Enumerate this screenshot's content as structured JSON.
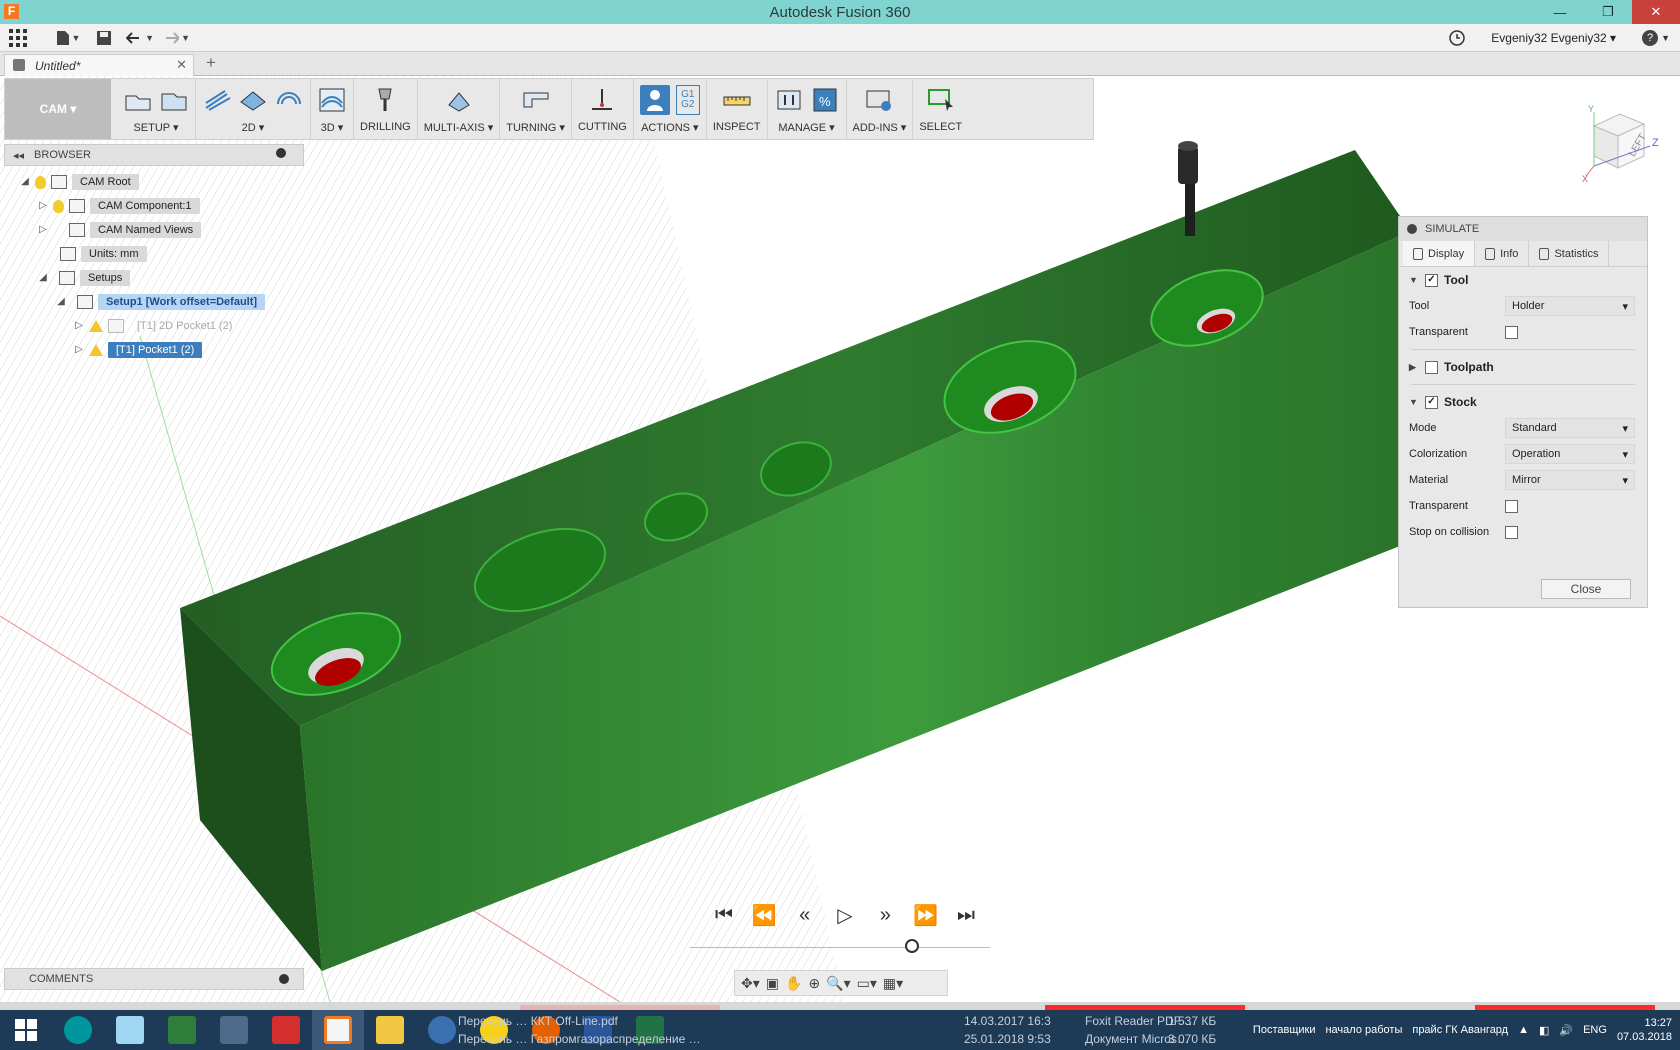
{
  "window": {
    "title": "Autodesk Fusion 360",
    "logo": "F",
    "minimize": "—",
    "restore": "❐",
    "close": "✕"
  },
  "qat": {
    "user": "Evgeniy32 Evgeniy32 ▾",
    "help": "?"
  },
  "doc_tab": {
    "title": "Untitled*",
    "close": "✕",
    "add": "+"
  },
  "toolbar": {
    "workspace": "CAM ▾",
    "groups": [
      {
        "label": "SETUP ▾"
      },
      {
        "label": "2D ▾"
      },
      {
        "label": "3D ▾"
      },
      {
        "label": "DRILLING"
      },
      {
        "label": "MULTI-AXIS ▾"
      },
      {
        "label": "TURNING ▾"
      },
      {
        "label": "CUTTING"
      },
      {
        "label": "ACTIONS ▾"
      },
      {
        "label": "INSPECT"
      },
      {
        "label": "MANAGE ▾"
      },
      {
        "label": "ADD-INS ▾"
      },
      {
        "label": "SELECT"
      }
    ],
    "g1g2": "G1 G2"
  },
  "browser": {
    "title": "BROWSER",
    "items": [
      {
        "label": "CAM Root"
      },
      {
        "label": "CAM Component:1"
      },
      {
        "label": "CAM Named Views"
      },
      {
        "label": "Units: mm"
      },
      {
        "label": "Setups"
      },
      {
        "label": "Setup1 [Work offset=Default]"
      },
      {
        "label": "[T1] 2D Pocket1 (2)"
      },
      {
        "label": "[T1] Pocket1 (2)"
      }
    ]
  },
  "comments": {
    "title": "COMMENTS"
  },
  "simulate": {
    "title": "SIMULATE",
    "tabs": [
      "Display",
      "Info",
      "Statistics"
    ],
    "tool_section": "Tool",
    "tool_label": "Tool",
    "tool_value": "Holder",
    "transparent_label": "Transparent",
    "toolpath_section": "Toolpath",
    "stock_section": "Stock",
    "mode_label": "Mode",
    "mode_value": "Standard",
    "colorization_label": "Colorization",
    "colorization_value": "Operation",
    "material_label": "Material",
    "material_value": "Mirror",
    "stock_transparent_label": "Transparent",
    "collision_label": "Stop on collision",
    "close_label": "Close",
    "tool_checked": true,
    "toolpath_checked": false,
    "stock_checked": true
  },
  "viewcube": {
    "face": "LEFT",
    "axis_x": "X",
    "axis_y": "Y",
    "axis_z": "Z"
  },
  "taskbar": {
    "files": [
      "Перечень … ККТ Off-Line.pdf",
      "14.03.2017 16:3",
      "Foxit Reader PDF …",
      "1 537 КБ",
      "Перечень … Газпромгазораспределение …",
      "25.01.2018 9:53",
      "Документ Micros…",
      "3 070 КБ"
    ],
    "tray_items": [
      "Поставщики",
      "начало работы",
      "прайс ГК Авангард"
    ],
    "lang": "ENG",
    "time": "13:27",
    "date": "07.03.2018"
  },
  "colors": {
    "accent": "#3d7fbd",
    "titlebar": "#7fd4cf",
    "stock_green": "#2f8a2f",
    "taskbar": "#1d3a57"
  }
}
